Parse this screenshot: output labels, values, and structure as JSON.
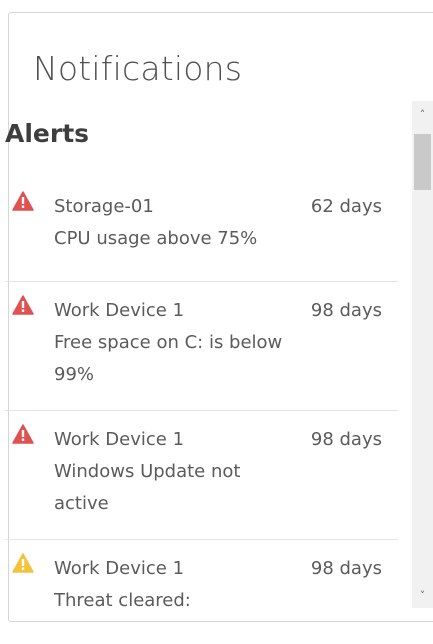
{
  "panel": {
    "title": "Notifications"
  },
  "alerts": {
    "heading": "Alerts",
    "items": [
      {
        "icon": "warning-triangle-icon",
        "severity_color": "#e05151",
        "device": "Storage-01",
        "message": "CPU usage above 75%",
        "age": "62 days"
      },
      {
        "icon": "warning-triangle-icon",
        "severity_color": "#e05151",
        "device": "Work Device 1",
        "message": "Free space on C: is below 99%",
        "age": "98 days"
      },
      {
        "icon": "warning-triangle-icon",
        "severity_color": "#e05151",
        "device": "Work Device 1",
        "message": "Windows Update not active",
        "age": "98 days"
      },
      {
        "icon": "warning-triangle-icon",
        "severity_color": "#f5c33b",
        "device": "Work Device 1",
        "message": "Threat cleared:",
        "age": "98 days"
      }
    ]
  },
  "scrollbar": {
    "up_icon": "scroll-up-arrow-icon",
    "down_icon": "scroll-down-arrow-icon",
    "up_glyph": "˄",
    "down_glyph": "˅"
  }
}
